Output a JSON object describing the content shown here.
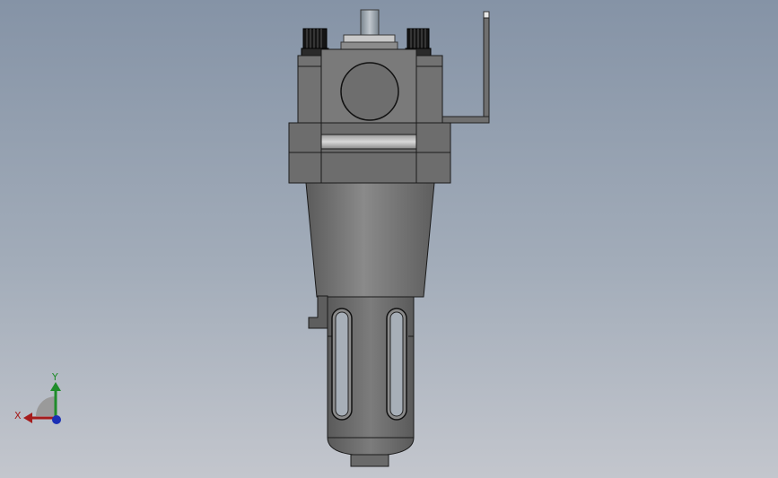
{
  "viewport": {
    "background_top": "#8593a6",
    "background_bottom": "#c3c6cd"
  },
  "model": {
    "body_color": "#707070",
    "edge_color": "#1a1a1a"
  },
  "triad": {
    "x_label": "X",
    "y_label": "Y",
    "x_color": "#a51c1c",
    "y_color": "#1f8c2a",
    "z_color": "#1a2fb5"
  }
}
